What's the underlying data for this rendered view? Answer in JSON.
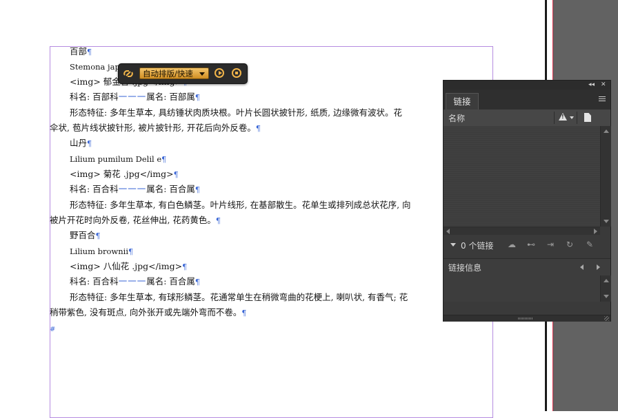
{
  "document": {
    "lines": [
      "百部",
      "Stemona japo",
      "<img> 郁金香 .jpg</img>",
      "科名: 百部科",
      "属名: 百部属",
      "形态特征: 多年生草本, 具纺锤状肉质块根。叶片长圆状披针形, 纸质, 边缘微有波状。花",
      "伞状, 苞片线状披针形, 被片披针形, 开花后向外反卷。",
      "山丹",
      "Lilium pumilum Delil e",
      "<img> 菊花 .jpg</img>",
      "科名: 百合科",
      "属名: 百合属",
      "形态特征: 多年生草本, 有白色鳞茎。叶片线形, 在基部散生。花单生或排列成总状花序, 向",
      "被片开花时向外反卷, 花丝伸出, 花药黄色。",
      "野百合",
      "Lilium brownii",
      "<img> 八仙花 .jpg</img>",
      "科名: 百合科",
      "属名: 百合属",
      "形态特征: 多年生草本, 有球形鳞茎。花通常单生在稍微弯曲的花梗上, 喇叭状, 有香气; 花",
      "稍带紫色, 没有斑点, 向外张开或先端外弯而不卷。"
    ],
    "pilcrow": "¶",
    "dashes": "一一一",
    "end_marker": "#"
  },
  "toolbar": {
    "mode_label": "自动排版/快速",
    "link_icon": "chain-link-icon",
    "play_icon": "play-icon",
    "stop_icon": "stop-icon"
  },
  "links_panel": {
    "collapse_label": "◂◂",
    "close_label": "✕",
    "tab_label": "链接",
    "column_name": "名称",
    "link_count": "0 个链接",
    "info_label": "链接信息",
    "icons": [
      "cloud-icon",
      "relink-icon",
      "goto-link-icon",
      "update-link-icon",
      "edit-original-icon"
    ]
  }
}
